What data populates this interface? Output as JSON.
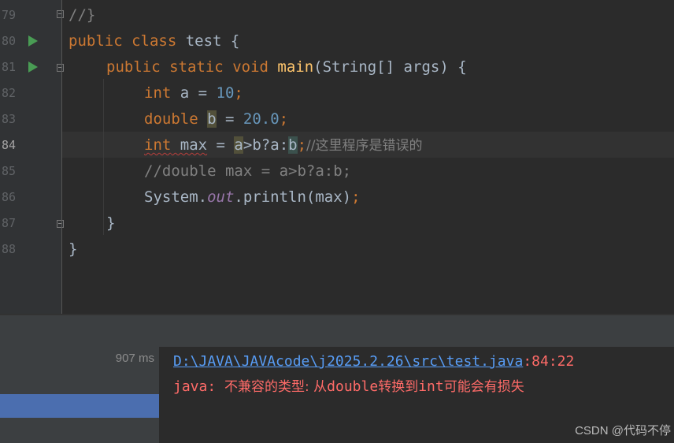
{
  "editor": {
    "line_numbers": [
      "79",
      "80",
      "81",
      "82",
      "83",
      "84",
      "85",
      "86",
      "87",
      "88"
    ],
    "lines": {
      "l79": {
        "comment": "//}"
      },
      "l80": {
        "kw_public": "public",
        "kw_class": "class",
        "class_name": " test {"
      },
      "l81": {
        "kw_public": "public",
        "kw_static": "static",
        "kw_void": "void",
        "method": "main",
        "params": "(String[] args) {"
      },
      "l82": {
        "kw_int": "int",
        "mid": " a = ",
        "num": "10",
        "semi": ";"
      },
      "l83": {
        "kw_double": "double",
        "pre": " ",
        "var_b": "b",
        "mid": " = ",
        "num": "20.0",
        "semi": ";"
      },
      "l84": {
        "kw_int": "int",
        "var_max": " max",
        "eq": " = ",
        "a1": "a",
        "gt": ">",
        "b1": "b",
        "q": "?",
        "a2": "a",
        "colon": ":",
        "b2": "b",
        "semi": ";",
        "comment": "//这里程序是错误的"
      },
      "l85": {
        "comment": "//double max = a>b?a:b;"
      },
      "l86": {
        "sys": "System.",
        "field": "out",
        "call": ".println(max)",
        "semi": ";"
      },
      "l87": {
        "brace": "}"
      },
      "l88": {
        "brace": "}"
      }
    }
  },
  "run_panel": {
    "duration": "907 ms"
  },
  "console": {
    "path_link": "D:\\JAVA\\JAVAcode\\j2025.2.26\\src\\test.java",
    "location": ":84:22",
    "error_prefix": "java: ",
    "error_cn1": "不兼容的类型: 从",
    "error_double": "double",
    "error_cn2": "转换到",
    "error_int": "int",
    "error_cn3": "可能会有损失"
  },
  "watermark": "CSDN @代码不停",
  "colors": {
    "editor_bg": "#2b2b2b",
    "keyword": "#cc7832",
    "method": "#ffc66d",
    "number": "#6897bb",
    "comment": "#808080",
    "link": "#589df6",
    "error": "#ff6b68",
    "selection": "#4b6eaf"
  }
}
